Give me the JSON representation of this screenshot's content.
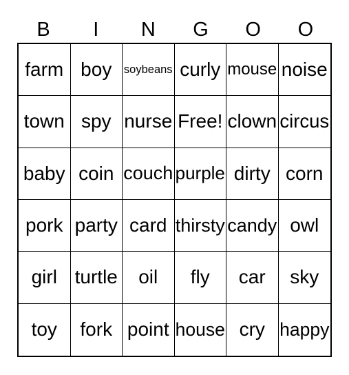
{
  "header": [
    "B",
    "I",
    "N",
    "G",
    "O",
    "O"
  ],
  "cells": [
    [
      "farm",
      "boy",
      "soybeans",
      "curly",
      "mouse",
      "noise"
    ],
    [
      "town",
      "spy",
      "nurse",
      "Free!",
      "clown",
      "circus"
    ],
    [
      "baby",
      "coin",
      "couch",
      "purple",
      "dirty",
      "corn"
    ],
    [
      "pork",
      "party",
      "card",
      "thirsty",
      "candy",
      "owl"
    ],
    [
      "girl",
      "turtle",
      "oil",
      "fly",
      "car",
      "sky"
    ],
    [
      "toy",
      "fork",
      "point",
      "house",
      "cry",
      "happy"
    ]
  ]
}
